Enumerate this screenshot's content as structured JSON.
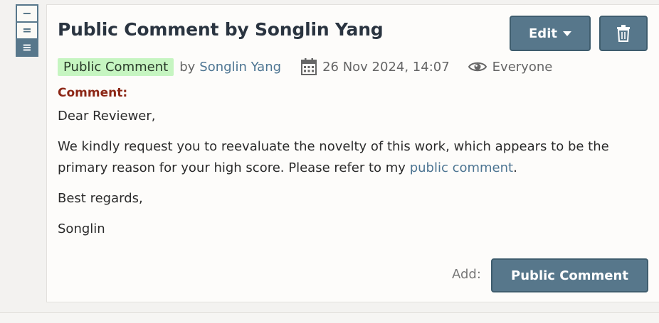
{
  "view_toggles": [
    {
      "glyph": "−",
      "active": false
    },
    {
      "glyph": "=",
      "active": false
    },
    {
      "glyph": "≡",
      "active": true
    }
  ],
  "note": {
    "title": "Public Comment by Songlin Yang",
    "edit_label": "Edit",
    "badge": "Public Comment",
    "by_label": "by",
    "author": "Songlin Yang",
    "date": "26 Nov 2024, 14:07",
    "readers": "Everyone",
    "field_label": "Comment:",
    "greeting": "Dear Reviewer,",
    "paragraph_text": "We kindly request you to reevaluate the novelty of this work, which appears to be the primary reason for your high score. Please refer to my ",
    "paragraph_link": "public comment",
    "paragraph_end": ".",
    "closing": "Best regards,",
    "signature": "Songlin"
  },
  "add": {
    "label": "Add:",
    "button": "Public Comment"
  },
  "colors": {
    "button_bg": "#57778b",
    "badge_bg": "#c6f5c1",
    "link": "#4d7592",
    "field_label": "#8c2716"
  },
  "icons": [
    "calendar-icon",
    "eye-icon",
    "trash-icon",
    "caret-down-icon"
  ]
}
